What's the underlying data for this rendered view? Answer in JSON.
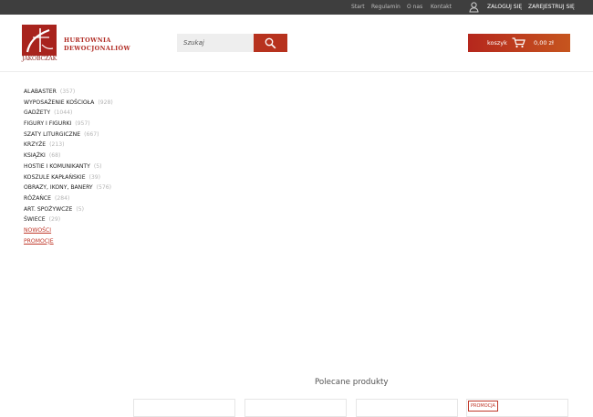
{
  "topbar": {
    "links": [
      "Start",
      "Regulamin",
      "O nas",
      "Kontakt"
    ],
    "login": "ZALOGUJ SIĘ",
    "register": "ZAREJESTRUJ SIĘ"
  },
  "brand": {
    "logo_text": "JAKÓBCZAK",
    "tagline_line1": "HURTOWNIA",
    "tagline_line2": "DEWOCJONALIÓW"
  },
  "search": {
    "placeholder": "Szukaj"
  },
  "cart": {
    "label": "koszyk",
    "total": "0,00 zł"
  },
  "categories": [
    {
      "label": "ALABASTER",
      "count": "(357)"
    },
    {
      "label": "WYPOSAŻENIE KOŚCIOŁA",
      "count": "(928)"
    },
    {
      "label": "GADŻETY",
      "count": "(1044)"
    },
    {
      "label": "FIGURY I FIGURKI",
      "count": "(957)"
    },
    {
      "label": "SZATY LITURGICZNE",
      "count": "(667)"
    },
    {
      "label": "KRZYŻE",
      "count": "(213)"
    },
    {
      "label": "KSIĄŻKI",
      "count": "(68)"
    },
    {
      "label": "HOSTIE I KOMUNIKANTY",
      "count": "(5)"
    },
    {
      "label": "KOSZULE KAPŁAŃSKIE",
      "count": "(39)"
    },
    {
      "label": "OBRAZY, IKONY, BANERY",
      "count": "(576)"
    },
    {
      "label": "RÓŻAŃCE",
      "count": "(284)"
    },
    {
      "label": "ART. SPOŻYWCZE",
      "count": "(5)"
    },
    {
      "label": "ŚWIECE",
      "count": "(29)"
    }
  ],
  "special_links": [
    "NOWOŚCI",
    "PROMOCJE"
  ],
  "recommended": {
    "title": "Polecane produkty",
    "badge": "PROMOCJA"
  },
  "colors": {
    "topbar": "#3e3e3e",
    "accent": "#b7321e",
    "brand_red": "#b02a22"
  },
  "icons": {
    "user": "user-icon",
    "search": "magnifier-icon",
    "cart": "cart-icon"
  }
}
